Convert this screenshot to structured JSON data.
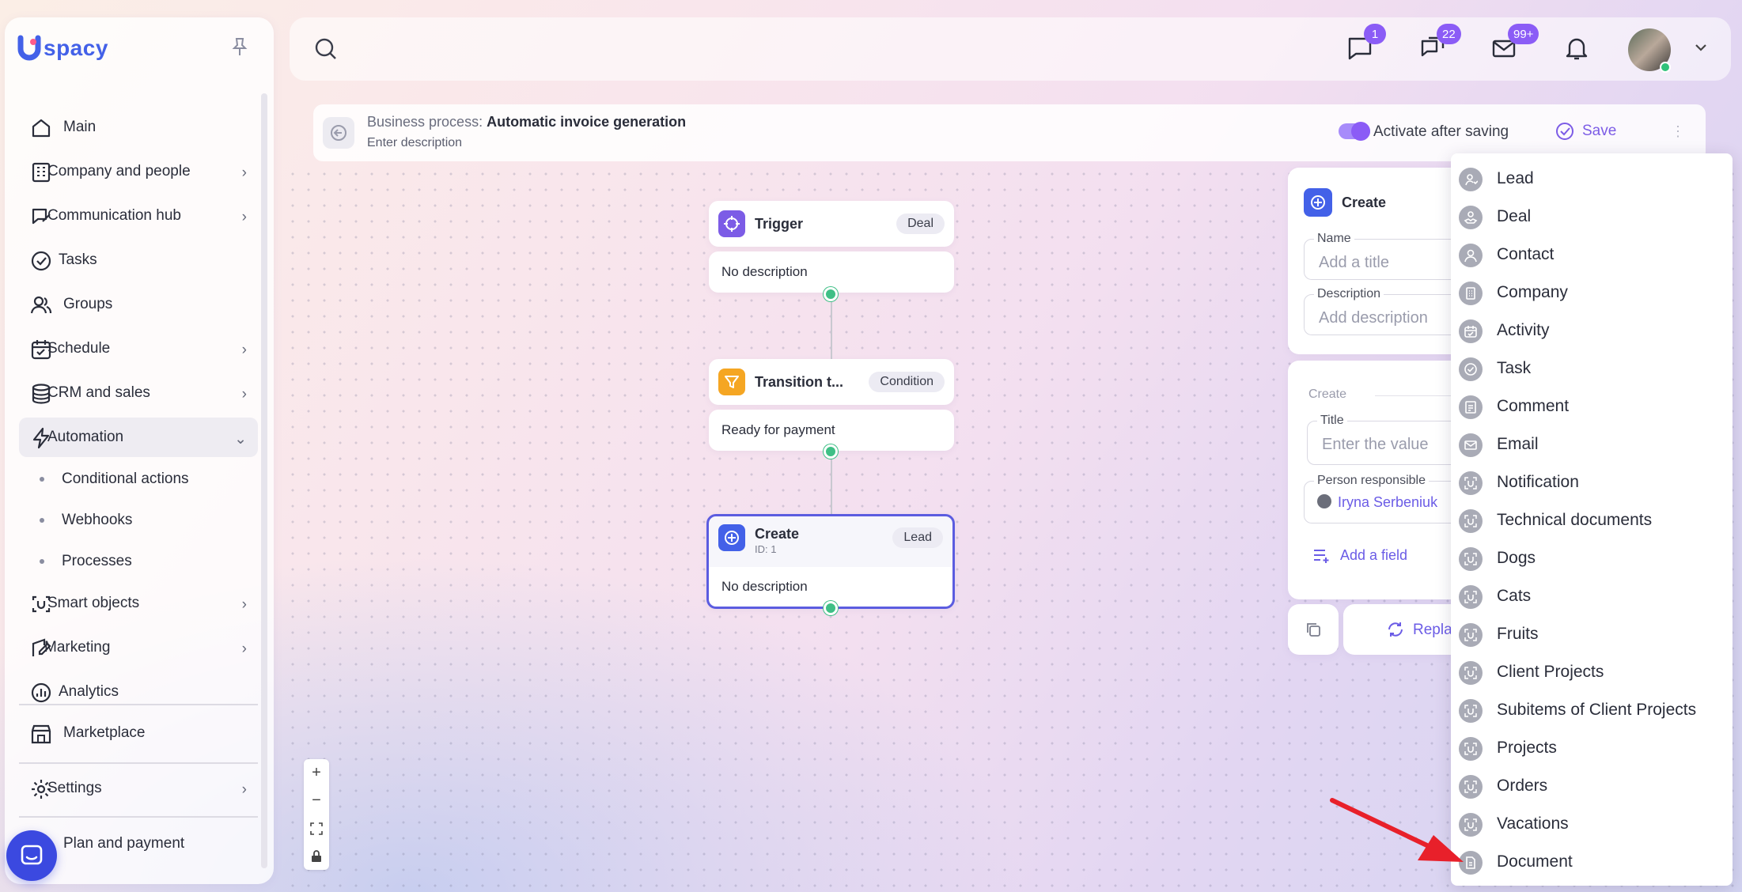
{
  "brand": {
    "logo_text": "spacy"
  },
  "sidebar": {
    "items": [
      {
        "label": "Main",
        "icon": "home-icon",
        "chevron": ""
      },
      {
        "label": "Company and people",
        "icon": "building-icon",
        "chevron": "›"
      },
      {
        "label": "Communication hub",
        "icon": "chat-edit-icon",
        "chevron": "›"
      },
      {
        "label": "Tasks",
        "icon": "check-circle-icon",
        "chevron": ""
      },
      {
        "label": "Groups",
        "icon": "users-icon",
        "chevron": ""
      },
      {
        "label": "Schedule",
        "icon": "calendar-icon",
        "chevron": "›"
      },
      {
        "label": "CRM and sales",
        "icon": "database-icon",
        "chevron": "›"
      },
      {
        "label": "Automation",
        "icon": "lightning-icon",
        "chevron": "⌄"
      }
    ],
    "subitems": [
      "Conditional actions",
      "Webhooks",
      "Processes"
    ],
    "items2": [
      {
        "label": "Smart objects",
        "icon": "smart-object-icon",
        "chevron": "›"
      },
      {
        "label": "Marketing",
        "icon": "marketing-icon",
        "chevron": "›"
      },
      {
        "label": "Analytics",
        "icon": "chart-icon",
        "chevron": ""
      }
    ],
    "marketplace": "Marketplace",
    "settings": "Settings",
    "plan": "Plan and payment"
  },
  "topbar": {
    "badges": {
      "messages": "1",
      "chats": "22",
      "mail": "99+"
    }
  },
  "process": {
    "prefix": "Business process: ",
    "name": "Automatic invoice generation",
    "description": "Enter description",
    "activate_label": "Activate after saving",
    "activate_on": true,
    "save_label": "Save"
  },
  "nodes": {
    "trigger": {
      "title": "Trigger",
      "tag": "Deal",
      "body": "No description"
    },
    "transition": {
      "title": "Transition t...",
      "tag": "Condition",
      "body": "Ready for payment"
    },
    "create": {
      "title": "Create",
      "id": "ID: 1",
      "tag": "Lead",
      "body": "No description"
    }
  },
  "panel": {
    "title": "Create",
    "name_label": "Name",
    "name_placeholder": "Add a title",
    "desc_label": "Description",
    "desc_placeholder": "Add description",
    "section_label": "Create",
    "title_label": "Title",
    "title_placeholder": "Enter the value",
    "person_label": "Person responsible",
    "person_value": "Iryna Serbeniuk",
    "add_field": "Add a field",
    "replace_label": "Repla"
  },
  "dropdown": {
    "items": [
      "Lead",
      "Deal",
      "Contact",
      "Company",
      "Activity",
      "Task",
      "Comment",
      "Email",
      "Notification",
      "Technical documents",
      "Dogs",
      "Cats",
      "Fruits",
      "Client Projects",
      "Subitems of Client Projects",
      "Projects",
      "Orders",
      "Vacations",
      "Document"
    ]
  },
  "colors": {
    "accent": "#7c5ce6",
    "primary": "#4361e8",
    "connector": "#3fbf86",
    "arrow": "#e8202a"
  }
}
